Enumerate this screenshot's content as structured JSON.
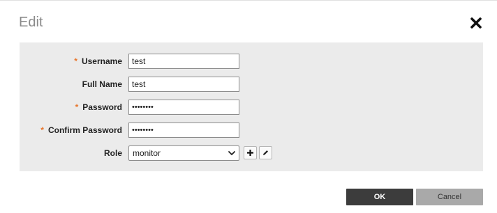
{
  "dialog": {
    "title": "Edit",
    "required_marker": "*",
    "fields": {
      "username": {
        "label": "Username",
        "value": "test",
        "required": true
      },
      "full_name": {
        "label": "Full Name",
        "value": "test",
        "required": false
      },
      "password": {
        "label": "Password",
        "value": "••••••••",
        "required": true
      },
      "confirm_password": {
        "label": "Confirm Password",
        "value": "••••••••",
        "required": true
      },
      "role": {
        "label": "Role",
        "value": "monitor"
      }
    },
    "buttons": {
      "ok": "OK",
      "cancel": "Cancel"
    },
    "icons": {
      "close": "close-icon",
      "add": "plus-icon",
      "edit": "pencil-icon"
    },
    "colors": {
      "required": "#e8772e",
      "ok_bg": "#3c3c3c",
      "cancel_bg": "#a9a9a9",
      "panel_bg": "#ebebeb"
    }
  }
}
